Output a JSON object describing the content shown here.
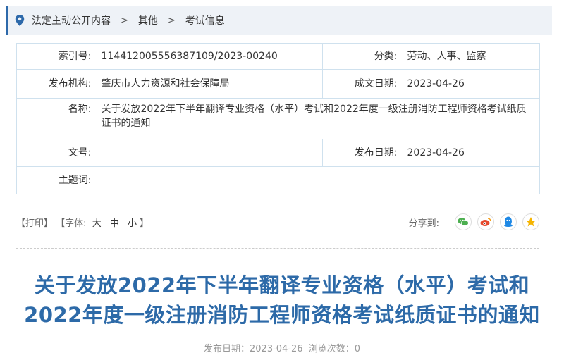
{
  "breadcrumb": {
    "items": [
      "法定主动公开内容",
      "其他",
      "考试信息"
    ],
    "separator": ">"
  },
  "meta": {
    "index_label": "索引号:",
    "index_value": "11441200555638710​9/2023-00240",
    "category_label": "分类:",
    "category_value": "劳动、人事、监察",
    "org_label": "发布机构:",
    "org_value": "肇庆市人力资源和社会保障局",
    "written_date_label": "成文日期:",
    "written_date_value": "2023-04-26",
    "name_label": "名称:",
    "name_value": "关于发放2022年下半年翻译专业资格（水平）考试和2022年度一级注册消防工程师资格考试纸质证书的通知",
    "doc_no_label": "文号:",
    "doc_no_value": "",
    "publish_date_label": "发布日期:",
    "publish_date_value": "2023-04-26",
    "keywords_label": "主题词:",
    "keywords_value": ""
  },
  "toolbar": {
    "print": "【打印】",
    "font_prefix": "【字体:",
    "font_large": "大",
    "font_medium": "中",
    "font_small": "小",
    "font_suffix": "】",
    "share_label": "分享到:"
  },
  "article": {
    "title_line1": "关于发放2022年下半年翻译专业资格（水平）考试和",
    "title_line2": "2022年度一级注册消防工程师资格考试纸质证书的通知",
    "publish_date": "发布日期：2023-04-26",
    "views": "浏览次数：0"
  },
  "colors": {
    "accent": "#2d6aa8",
    "wechat": "#4caf50",
    "weibo": "#e6492d",
    "qq": "#1e88e5",
    "qzone": "#f5b400"
  }
}
